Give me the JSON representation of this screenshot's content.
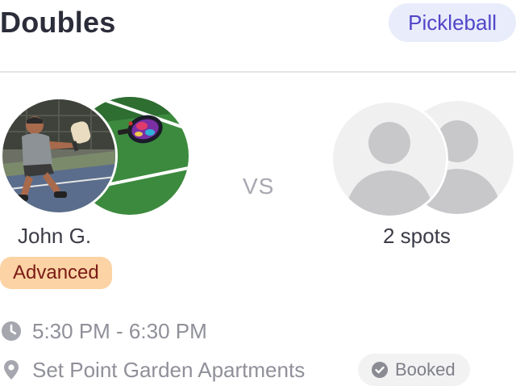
{
  "event": {
    "title": "Doubles",
    "sport": "Pickleball"
  },
  "matchup": {
    "vs_label": "VS",
    "team_a": {
      "player_name": "John G.",
      "skill_level": "Advanced"
    },
    "team_b": {
      "open_spots": "2 spots"
    }
  },
  "details": {
    "time": "5:30 PM - 6:30 PM",
    "location": "Set Point Garden Apartments",
    "status": "Booked"
  },
  "icons": {
    "time": "clock-icon",
    "location": "map-pin-icon",
    "status": "check-circle-icon",
    "empty_avatar": "user-placeholder-icon"
  },
  "colors": {
    "sport_pill_bg": "#e8ecfb",
    "sport_pill_text": "#5046c8",
    "level_badge_bg": "#fcd3a4",
    "level_badge_text": "#7a1a16",
    "muted_text": "#8f9099",
    "court_green": "#3c8a3e"
  }
}
